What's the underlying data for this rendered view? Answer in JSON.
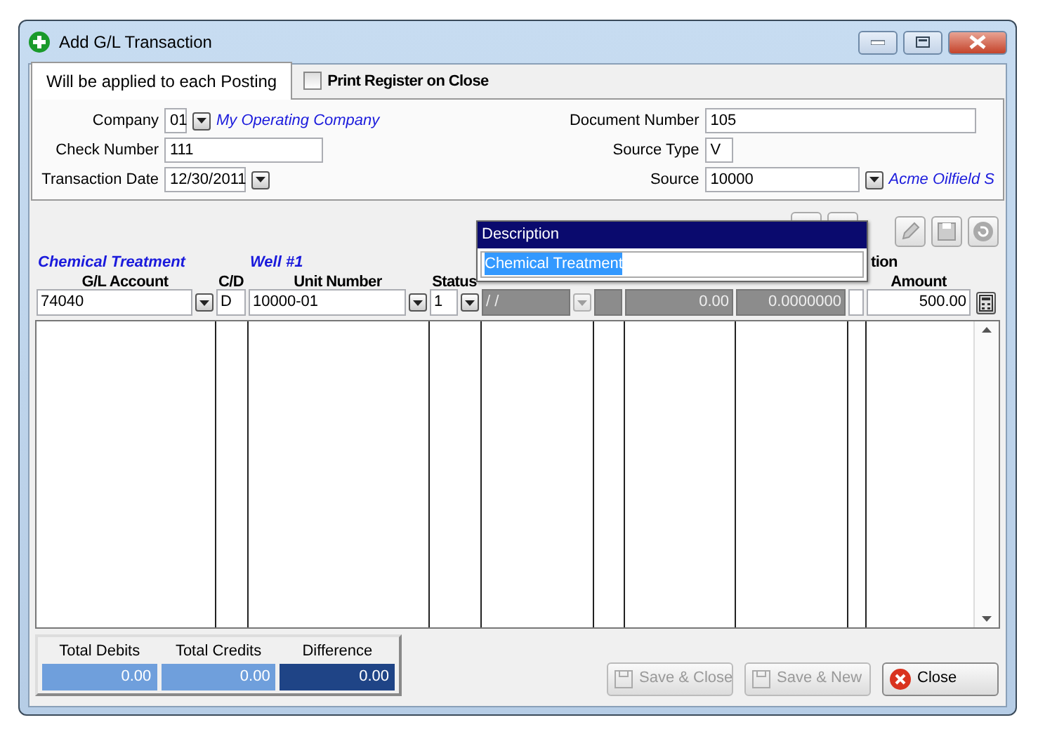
{
  "window": {
    "title": "Add G/L Transaction"
  },
  "tab": {
    "label": "Will be applied to each Posting",
    "selected": true
  },
  "print_register": {
    "label": "Print Register on Close",
    "checked": false
  },
  "fields_left": [
    {
      "label": "Company",
      "value": "01",
      "kind": "combo",
      "link": "My Operating Company"
    },
    {
      "label": "Check Number",
      "value": "111",
      "kind": "text"
    },
    {
      "label": "Transaction Date",
      "value": "12/30/2011",
      "kind": "date"
    }
  ],
  "fields_right": [
    {
      "label": "Document Number",
      "value": "105",
      "kind": "text"
    },
    {
      "label": "Source Type",
      "value": "V",
      "kind": "short"
    },
    {
      "label": "Source",
      "value": "10000",
      "kind": "combo",
      "link": "Acme Oilfield S"
    }
  ],
  "columns": [
    {
      "caption": "Chemical Treatment",
      "header": "G/L Account",
      "kind": "combo",
      "value": "74040",
      "disabled": false
    },
    {
      "header": "C/D",
      "kind": "text",
      "value": "D",
      "disabled": false
    },
    {
      "caption": "Well #1",
      "header": "Unit Number",
      "kind": "combo",
      "value": "10000-01",
      "disabled": false
    },
    {
      "header": "Status",
      "kind": "smallcombo",
      "value": "1",
      "disabled": false
    },
    {
      "kind": "date",
      "value": "/ /",
      "disabled": true
    },
    {
      "kind": "text",
      "disabled": true
    },
    {
      "kind": "number",
      "value": "0.00",
      "disabled": true
    },
    {
      "kind": "number",
      "value": "0.0000000",
      "disabled": true
    },
    {
      "caption": "tion",
      "kind": "text",
      "disabled": false
    },
    {
      "header": "Amount",
      "kind": "number",
      "value": "500.00",
      "disabled": false
    }
  ],
  "description_popup": {
    "title": "Description",
    "value": "Chemical Treatment"
  },
  "totals": [
    {
      "label": "Total Debits",
      "value": "0.00",
      "kind": "light"
    },
    {
      "label": "Total Credits",
      "value": "0.00",
      "kind": "light"
    },
    {
      "label": "Difference",
      "value": "0.00",
      "kind": "dark"
    }
  ],
  "buttons": [
    {
      "label": "Save & Close",
      "kind": "save",
      "disabled": true
    },
    {
      "label": "Save & New",
      "kind": "save",
      "disabled": true
    },
    {
      "label": "Close",
      "kind": "close",
      "disabled": false
    }
  ]
}
